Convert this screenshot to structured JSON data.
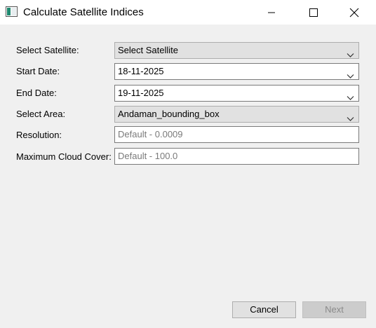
{
  "window": {
    "title": "Calculate Satellite Indices",
    "controls": {
      "minimize": "minimize-icon",
      "maximize": "maximize-icon",
      "close": "close-icon"
    }
  },
  "form": {
    "satellite": {
      "label": "Select Satellite:",
      "value": "Select Satellite"
    },
    "start_date": {
      "label": "Start Date:",
      "value": "18-11-2025"
    },
    "end_date": {
      "label": "End Date:",
      "value": "19-11-2025"
    },
    "area": {
      "label": "Select Area:",
      "value": "Andaman_bounding_box"
    },
    "resolution": {
      "label": "Resolution:",
      "placeholder": "Default - 0.0009"
    },
    "cloud_cover": {
      "label": "Maximum Cloud Cover:",
      "placeholder": "Default - 100.0"
    }
  },
  "buttons": {
    "cancel": "Cancel",
    "next": "Next"
  },
  "colors": {
    "dialog_background": "#f0f0f0",
    "titlebar_background": "#ffffff",
    "combo_gray": "#e1e1e1",
    "disabled_text": "#8a8a8a",
    "icon_accent": "#1f8a70"
  }
}
